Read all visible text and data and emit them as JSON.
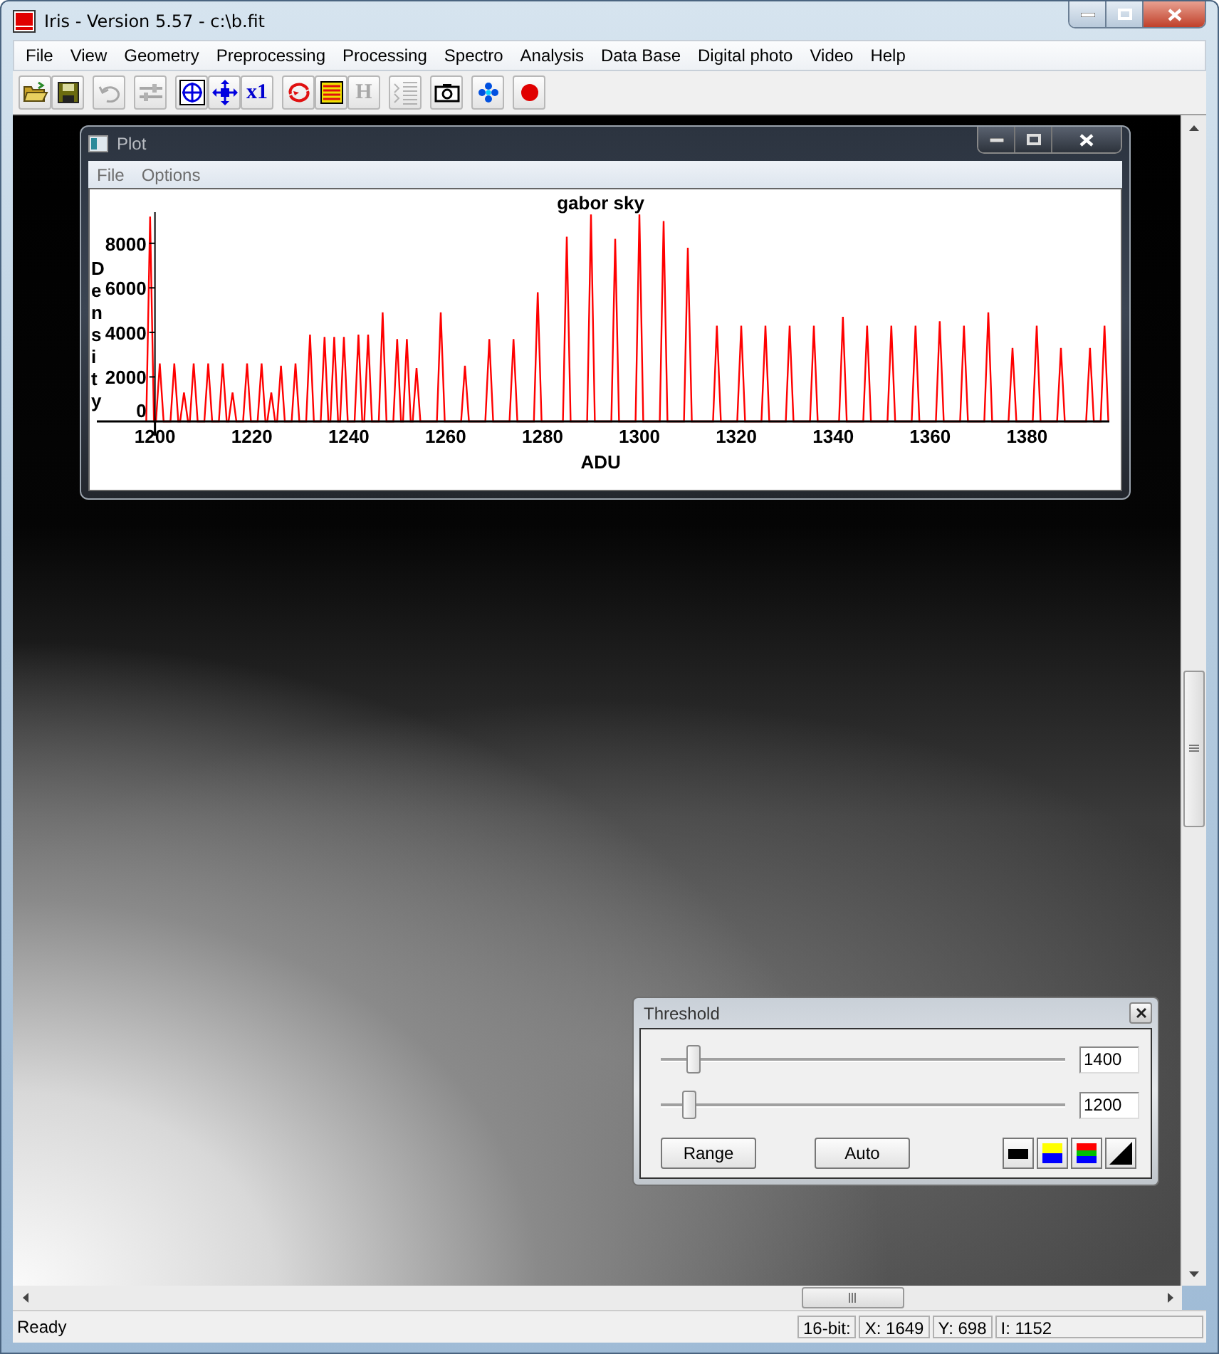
{
  "window": {
    "title": "Iris - Version 5.57 - c:\\b.fit"
  },
  "menu": [
    "File",
    "View",
    "Geometry",
    "Preprocessing",
    "Processing",
    "Spectro",
    "Analysis",
    "Data Base",
    "Digital photo",
    "Video",
    "Help"
  ],
  "toolbar": {
    "groups": [
      [
        {
          "kind": "folder",
          "disabled": false
        },
        {
          "kind": "save",
          "disabled": false
        }
      ],
      [
        {
          "kind": "undo",
          "disabled": true
        }
      ],
      [
        {
          "kind": "sliders",
          "disabled": true
        }
      ],
      [
        {
          "kind": "target",
          "disabled": false
        },
        {
          "kind": "move",
          "disabled": false
        },
        {
          "kind": "text",
          "label": "x1",
          "disabled": false
        }
      ],
      [
        {
          "kind": "swirl",
          "disabled": false
        },
        {
          "kind": "stripes",
          "disabled": false
        },
        {
          "kind": "text",
          "label": "H",
          "disabled": true
        }
      ],
      [
        {
          "kind": "list",
          "disabled": true
        }
      ],
      [
        {
          "kind": "camera",
          "disabled": false
        }
      ],
      [
        {
          "kind": "diamond",
          "disabled": false
        }
      ],
      [
        {
          "kind": "dot",
          "disabled": false
        }
      ]
    ]
  },
  "plot_window": {
    "title": "Plot",
    "menu": [
      "File",
      "Options"
    ],
    "chart_data": {
      "type": "line",
      "title": "gabor sky",
      "xlabel": "ADU",
      "ylabel": "Density",
      "x": [
        1198.2,
        1199,
        1199.8,
        1200.2,
        1201,
        1201.8,
        1203.2,
        1204,
        1204.8,
        1205.2,
        1206,
        1206.8,
        1207.2,
        1208,
        1208.8,
        1210.2,
        1211,
        1211.8,
        1213.2,
        1214,
        1214.8,
        1215.2,
        1216,
        1216.8,
        1218.2,
        1219,
        1219.8,
        1221.2,
        1222,
        1222.8,
        1223.2,
        1224,
        1224.8,
        1225.2,
        1226,
        1226.8,
        1228.2,
        1229,
        1229.8,
        1231.2,
        1232,
        1232.8,
        1234.2,
        1235,
        1235.8,
        1236.2,
        1237,
        1237.8,
        1238.2,
        1239,
        1239.8,
        1241.2,
        1242,
        1242.8,
        1243.2,
        1244,
        1244.8,
        1246.2,
        1247,
        1247.8,
        1249.2,
        1250,
        1250.8,
        1251.2,
        1252,
        1252.8,
        1253.2,
        1254,
        1254.8,
        1258.2,
        1259,
        1259.8,
        1263.2,
        1264,
        1264.8,
        1268.2,
        1269,
        1269.8,
        1273.2,
        1274,
        1274.8,
        1278.2,
        1279,
        1279.8,
        1284.2,
        1285,
        1285.8,
        1289.2,
        1290,
        1290.8,
        1294.2,
        1295,
        1295.8,
        1299.2,
        1300,
        1300.8,
        1304.2,
        1305,
        1305.8,
        1309.2,
        1310,
        1310.8,
        1315.2,
        1316,
        1316.8,
        1320.2,
        1321,
        1321.8,
        1325.2,
        1326,
        1326.8,
        1330.2,
        1331,
        1331.8,
        1335.2,
        1336,
        1336.8,
        1341.2,
        1342,
        1342.8,
        1346.2,
        1347,
        1347.8,
        1351.2,
        1352,
        1352.8,
        1356.2,
        1357,
        1357.8,
        1361.2,
        1362,
        1362.8,
        1366.2,
        1367,
        1367.8,
        1371.2,
        1372,
        1372.8,
        1376.2,
        1377,
        1377.8,
        1381.2,
        1382,
        1382.8,
        1386.2,
        1387,
        1387.8,
        1392.2,
        1393,
        1393.8,
        1395.2,
        1396,
        1396.8
      ],
      "series": [
        {
          "color": "#ff0000",
          "values": [
            0,
            9200,
            0,
            0,
            2600,
            0,
            0,
            2600,
            0,
            0,
            1300,
            0,
            0,
            2600,
            0,
            0,
            2600,
            0,
            0,
            2600,
            0,
            0,
            1300,
            0,
            0,
            2600,
            0,
            0,
            2600,
            0,
            0,
            1300,
            0,
            0,
            2500,
            0,
            0,
            2600,
            0,
            0,
            3900,
            0,
            0,
            3800,
            0,
            0,
            3800,
            0,
            0,
            3800,
            0,
            0,
            3900,
            0,
            0,
            3900,
            0,
            0,
            4900,
            0,
            0,
            3700,
            0,
            0,
            3700,
            0,
            0,
            2400,
            0,
            0,
            4900,
            0,
            0,
            2500,
            0,
            0,
            3700,
            0,
            0,
            3700,
            0,
            0,
            5800,
            0,
            0,
            8300,
            0,
            0,
            9300,
            0,
            0,
            8200,
            0,
            0,
            9300,
            0,
            0,
            9000,
            0,
            0,
            7800,
            0,
            0,
            4300,
            0,
            0,
            4300,
            0,
            0,
            4300,
            0,
            0,
            4300,
            0,
            0,
            4300,
            0,
            0,
            4700,
            0,
            0,
            4300,
            0,
            0,
            4300,
            0,
            0,
            4300,
            0,
            0,
            4500,
            0,
            0,
            4300,
            0,
            0,
            4900,
            0,
            0,
            3300,
            0,
            0,
            4300,
            0,
            0,
            3300,
            0,
            0,
            3300,
            0,
            0,
            4300,
            0
          ]
        }
      ],
      "xlim": [
        1188,
        1397
      ],
      "ylim": [
        0,
        9400
      ],
      "xticks": [
        1200,
        1220,
        1240,
        1260,
        1280,
        1300,
        1320,
        1340,
        1360,
        1380
      ],
      "yticks": [
        0,
        2000,
        4000,
        6000,
        8000
      ]
    }
  },
  "threshold_window": {
    "title": "Threshold",
    "sliders": [
      {
        "level": 0.067,
        "value": "1400"
      },
      {
        "level": 0.053,
        "value": "1200"
      }
    ],
    "buttons": [
      "Range",
      "Auto"
    ],
    "palette_buttons": [
      {
        "kind": "mono"
      },
      {
        "kind": "yellow-blue"
      },
      {
        "kind": "rgb"
      },
      {
        "kind": "ramp"
      }
    ]
  },
  "status_bar": {
    "message": "Ready",
    "panes": [
      "16-bit:",
      "X: 1649",
      "Y: 698",
      "I: 1152"
    ]
  }
}
